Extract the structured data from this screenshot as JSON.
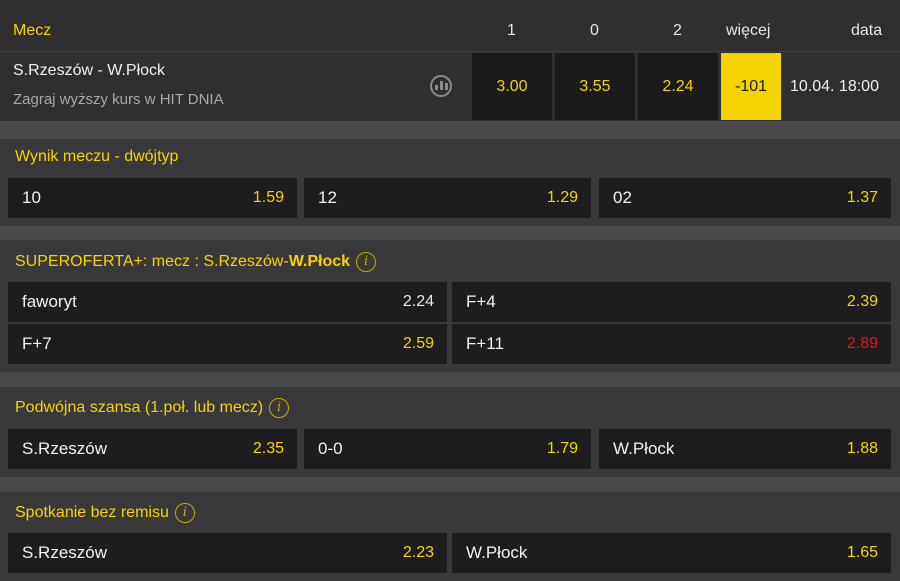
{
  "header": {
    "mecz": "Mecz",
    "col1": "1",
    "col0": "0",
    "col2": "2",
    "more": "więcej",
    "date": "data"
  },
  "match": {
    "name": "S.Rzeszów - W.Płock",
    "subtitle": "Zagraj wyższy kurs w HIT DNIA",
    "odd1": "3.00",
    "odd0": "3.55",
    "odd2": "2.24",
    "more": "-101",
    "date": "10.04. 18:00",
    "stats_icon": "bar-chart-icon"
  },
  "sections": {
    "double": {
      "title": "Wynik meczu - dwójtyp",
      "items": [
        {
          "label": "10",
          "odd": "1.59"
        },
        {
          "label": "12",
          "odd": "1.29"
        },
        {
          "label": "02",
          "odd": "1.37"
        }
      ]
    },
    "super": {
      "title_prefix": "SUPEROFERTA+: mecz : S.Rzeszów-",
      "title_bold": "W.Płock",
      "info_icon": "info-icon",
      "items": [
        {
          "label": "faworyt",
          "odd": "2.24"
        },
        {
          "label": "F+4",
          "odd": "2.39"
        },
        {
          "label": "F+7",
          "odd": "2.59"
        },
        {
          "label": "F+11",
          "odd": "2.89"
        }
      ]
    },
    "chance": {
      "title": "Podwójna szansa (1.poł. lub mecz)",
      "info_icon": "info-icon",
      "items": [
        {
          "label": "S.Rzeszów",
          "odd": "2.35"
        },
        {
          "label": "0-0",
          "odd": "1.79"
        },
        {
          "label": "W.Płock",
          "odd": "1.88"
        }
      ]
    },
    "nodraw": {
      "title": "Spotkanie bez remisu",
      "info_icon": "info-icon",
      "items": [
        {
          "label": "S.Rzeszów",
          "odd": "2.23"
        },
        {
          "label": "W.Płock",
          "odd": "1.65"
        }
      ]
    }
  },
  "colors": {
    "accent": "#f5d300",
    "highlight_red": "#e01515",
    "background": "#2a2a2d",
    "cell": "#1d1d1f"
  }
}
